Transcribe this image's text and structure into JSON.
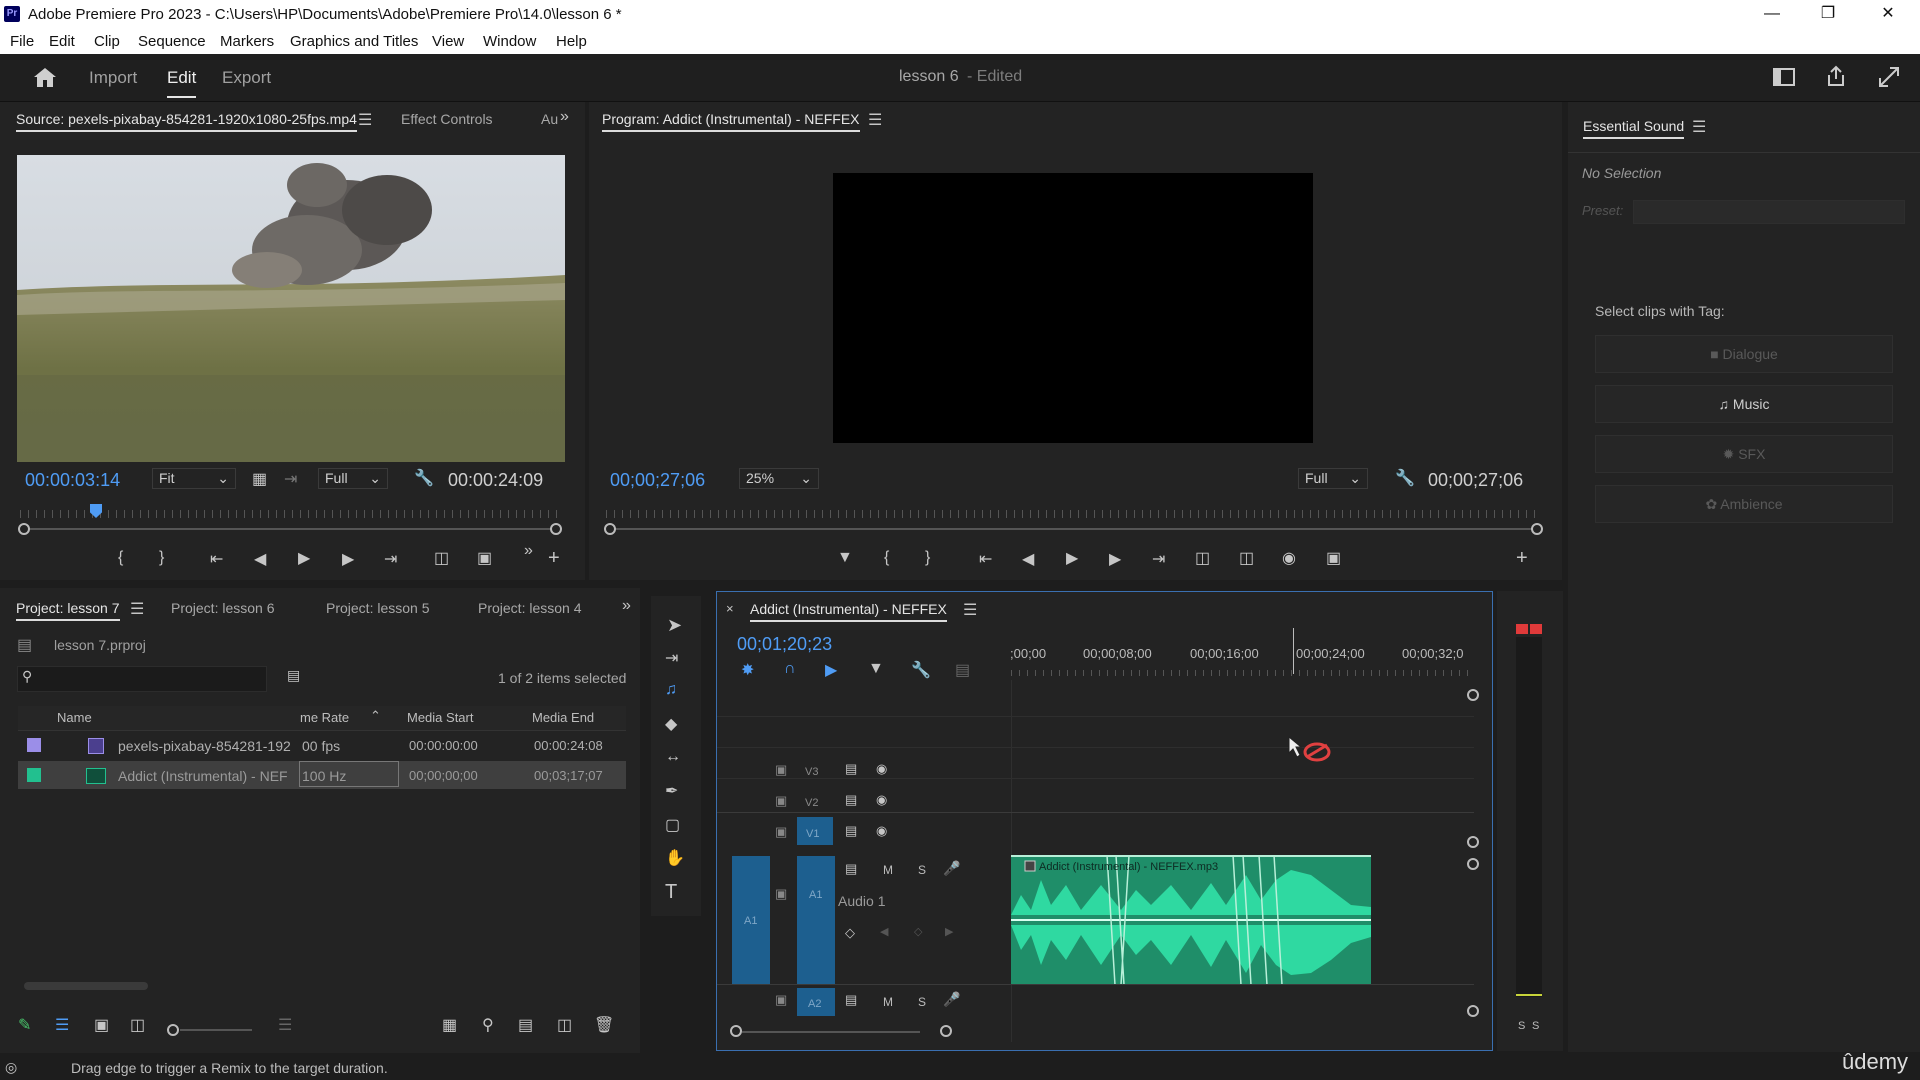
{
  "window": {
    "title": "Adobe Premiere Pro 2023 - C:\\Users\\HP\\Documents\\Adobe\\Premiere Pro\\14.0\\lesson 6 *",
    "app_icon": "Pr"
  },
  "menu": [
    "File",
    "Edit",
    "Clip",
    "Sequence",
    "Markers",
    "Graphics and Titles",
    "View",
    "Window",
    "Help"
  ],
  "header": {
    "tabs": [
      "Import",
      "Edit",
      "Export"
    ],
    "active_tab": "Edit",
    "project_name": "lesson 6",
    "status": "- Edited"
  },
  "source": {
    "tab": "Source: pexels-pixabay-854281-1920x1080-25fps.mp4",
    "tabs_other": [
      "Effect Controls",
      "Au"
    ],
    "timecode": "00:00:03:14",
    "fit": "Fit",
    "quality": "Full",
    "duration": "00:00:24:09"
  },
  "program": {
    "tab": "Program: Addict (Instrumental) - NEFFEX",
    "timecode": "00;00;27;06",
    "zoom": "25%",
    "quality": "Full",
    "duration": "00;00;27;06"
  },
  "essential_sound": {
    "title": "Essential Sound",
    "no_selection": "No Selection",
    "preset_label": "Preset:",
    "tag_heading": "Select clips with Tag:",
    "tags": [
      "Dialogue",
      "Music",
      "SFX",
      "Ambience"
    ]
  },
  "project": {
    "tabs": [
      "Project: lesson 7",
      "Project: lesson 6",
      "Project: lesson 5",
      "Project: lesson 4"
    ],
    "file": "lesson 7.prproj",
    "selection_status": "1 of 2 items selected",
    "columns": [
      "Name",
      "me Rate",
      "Media Start",
      "Media End"
    ],
    "rows": [
      {
        "name": "pexels-pixabay-854281-192",
        "rate": "00 fps",
        "start": "00:00:00:00",
        "end": "00:00:24:08",
        "color": "#9b8ee8"
      },
      {
        "name": "Addict (Instrumental) - NEF",
        "rate": "100 Hz",
        "start": "00;00;00;00",
        "end": "00;03;17;07",
        "color": "#22c08f"
      }
    ]
  },
  "timeline": {
    "tab": "Addict (Instrumental) - NEFFEX",
    "timecode": "00;01;20;23",
    "ruler": [
      ";00;00",
      "00;00;08;00",
      "00;00;16;00",
      "00;00;24;00",
      "00;00;32;0"
    ],
    "video_tracks": [
      "V3",
      "V2",
      "V1"
    ],
    "audio_tracks": [
      "A1",
      "A2"
    ],
    "audio_track_name": "Audio 1",
    "clip_name": "Addict (Instrumental) - NEFFEX.mp3",
    "track_buttons": {
      "mute": "M",
      "solo": "S"
    },
    "meter_labels": [
      "S",
      "S"
    ]
  },
  "status_bar": {
    "text": "Drag edge to trigger a Remix to the target duration."
  },
  "watermark": "ûdemy",
  "colors": {
    "accent_blue": "#4f9cf5",
    "clip_green": "#2bbf8f",
    "selected_blue": "#1d5f8f"
  }
}
